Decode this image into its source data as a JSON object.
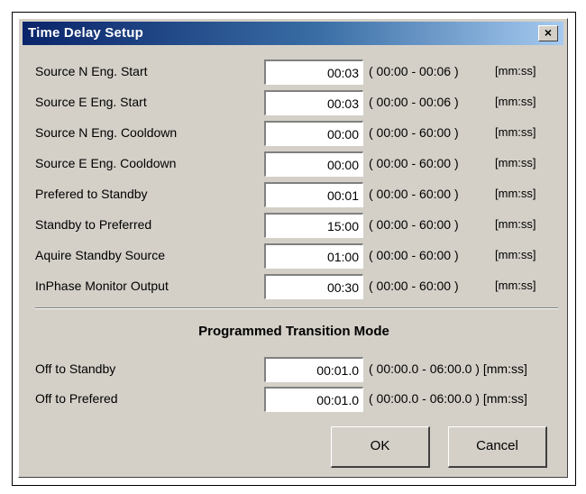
{
  "window": {
    "title": "Time Delay Setup",
    "close_label": "×"
  },
  "delays": [
    {
      "label": "Source N Eng. Start",
      "value": "00:03",
      "range": "( 00:00 - 00:06 )",
      "unit": "[mm:ss]"
    },
    {
      "label": "Source E Eng. Start",
      "value": "00:03",
      "range": "( 00:00 - 00:06 )",
      "unit": "[mm:ss]"
    },
    {
      "label": "Source N Eng. Cooldown",
      "value": "00:00",
      "range": "( 00:00 - 60:00 )",
      "unit": "[mm:ss]"
    },
    {
      "label": "Source E Eng. Cooldown",
      "value": "00:00",
      "range": "( 00:00 - 60:00 )",
      "unit": "[mm:ss]"
    },
    {
      "label": "Prefered to Standby",
      "value": "00:01",
      "range": "( 00:00 - 60:00 )",
      "unit": "[mm:ss]"
    },
    {
      "label": "Standby to Preferred",
      "value": "15:00",
      "range": "( 00:00 - 60:00 )",
      "unit": "[mm:ss]"
    },
    {
      "label": "Aquire Standby Source",
      "value": "01:00",
      "range": "( 00:00 - 60:00 )",
      "unit": "[mm:ss]"
    },
    {
      "label": "InPhase Monitor Output",
      "value": "00:30",
      "range": "( 00:00 - 60:00 )",
      "unit": "[mm:ss]"
    }
  ],
  "transition": {
    "title": "Programmed Transition Mode",
    "rows": [
      {
        "label": "Off to Standby",
        "value": "00:01.0",
        "range": "( 00:00.0 - 06:00.0 ) [mm:ss]"
      },
      {
        "label": "Off to Prefered",
        "value": "00:01.0",
        "range": "( 00:00.0 - 06:00.0 ) [mm:ss]"
      }
    ]
  },
  "buttons": {
    "ok": "OK",
    "cancel": "Cancel"
  }
}
